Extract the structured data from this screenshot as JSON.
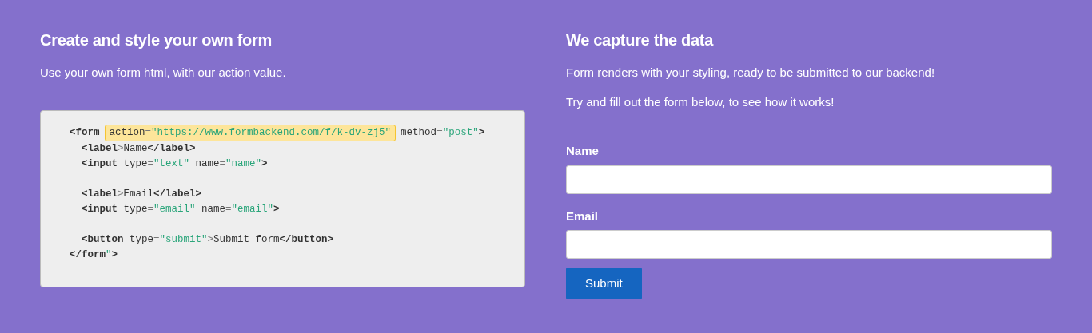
{
  "left": {
    "heading": "Create and style your own form",
    "intro": "Use your own form html, with our action value.",
    "code_lines": [
      {
        "kind": "code",
        "segments": [
          {
            "highlighted": false,
            "tokens": [
              {
                "kind": "tag",
                "text": "<form"
              }
            ]
          },
          {
            "highlighted": true,
            "tokens": [
              {
                "kind": "attr",
                "text": "action"
              },
              {
                "kind": "punct",
                "text": "="
              },
              {
                "kind": "string",
                "text": "\"https://www.formbackend.com/f/k-dv-zj5\""
              }
            ]
          },
          {
            "highlighted": false,
            "tokens": [
              {
                "kind": "attr",
                "text": "method"
              },
              {
                "kind": "punct",
                "text": "="
              },
              {
                "kind": "string",
                "text": "\"post\""
              },
              {
                "kind": "tag",
                "text": ">"
              }
            ]
          }
        ]
      },
      {
        "kind": "code",
        "segments": [
          {
            "highlighted": false,
            "tokens": [
              {
                "kind": "tag",
                "text": "  <label"
              },
              {
                "kind": "punct",
                "text": ">"
              },
              {
                "kind": "text",
                "text": "Name"
              },
              {
                "kind": "tag",
                "text": "</label>"
              }
            ]
          }
        ]
      },
      {
        "kind": "code",
        "segments": [
          {
            "highlighted": false,
            "tokens": [
              {
                "kind": "tag",
                "text": "  <input"
              },
              {
                "kind": "attr",
                "text": " type"
              },
              {
                "kind": "punct",
                "text": "="
              },
              {
                "kind": "string",
                "text": "\"text\""
              },
              {
                "kind": "attr",
                "text": " name"
              },
              {
                "kind": "punct",
                "text": "="
              },
              {
                "kind": "string",
                "text": "\"name\""
              },
              {
                "kind": "tag",
                "text": ">"
              }
            ]
          }
        ]
      },
      {
        "kind": "blank"
      },
      {
        "kind": "code",
        "segments": [
          {
            "highlighted": false,
            "tokens": [
              {
                "kind": "tag",
                "text": "  <label"
              },
              {
                "kind": "punct",
                "text": ">"
              },
              {
                "kind": "text",
                "text": "Email"
              },
              {
                "kind": "tag",
                "text": "</label>"
              }
            ]
          }
        ]
      },
      {
        "kind": "code",
        "segments": [
          {
            "highlighted": false,
            "tokens": [
              {
                "kind": "tag",
                "text": "  <input"
              },
              {
                "kind": "attr",
                "text": " type"
              },
              {
                "kind": "punct",
                "text": "="
              },
              {
                "kind": "string",
                "text": "\"email\""
              },
              {
                "kind": "attr",
                "text": " name"
              },
              {
                "kind": "punct",
                "text": "="
              },
              {
                "kind": "string",
                "text": "\"email\""
              },
              {
                "kind": "tag",
                "text": ">"
              }
            ]
          }
        ]
      },
      {
        "kind": "blank"
      },
      {
        "kind": "code",
        "segments": [
          {
            "highlighted": false,
            "tokens": [
              {
                "kind": "tag",
                "text": "  <button"
              },
              {
                "kind": "attr",
                "text": " type"
              },
              {
                "kind": "punct",
                "text": "="
              },
              {
                "kind": "string",
                "text": "\"submit\""
              },
              {
                "kind": "punct",
                "text": ">"
              },
              {
                "kind": "text",
                "text": "Submit form"
              },
              {
                "kind": "tag",
                "text": "</button>"
              }
            ]
          }
        ]
      },
      {
        "kind": "code",
        "segments": [
          {
            "highlighted": false,
            "tokens": [
              {
                "kind": "tag",
                "text": "</form"
              },
              {
                "kind": "string",
                "text": "\""
              },
              {
                "kind": "tag",
                "text": ">"
              }
            ]
          }
        ]
      }
    ]
  },
  "right": {
    "heading": "We capture the data",
    "paragraphs": [
      "Form renders with your styling, ready to be submitted to our backend!",
      "Try and fill out the form below, to see how it works!"
    ],
    "fields": [
      {
        "label": "Name"
      },
      {
        "label": "Email"
      }
    ],
    "submit": "Submit"
  }
}
